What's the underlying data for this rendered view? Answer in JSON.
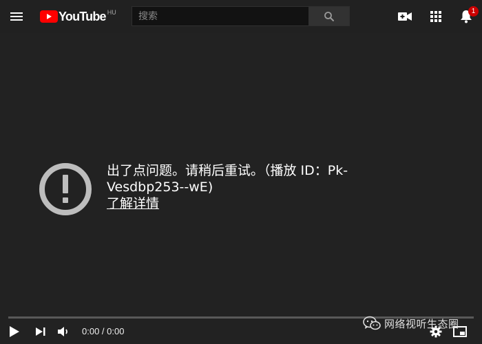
{
  "header": {
    "brand": "YouTube",
    "region": "HU",
    "search": {
      "placeholder": "搜索",
      "value": ""
    },
    "icons": {
      "menu": "hamburger-icon",
      "search": "search-icon",
      "create": "video-camera-icon",
      "apps": "apps-grid-icon",
      "notifications": "bell-icon"
    },
    "notification_count": "1"
  },
  "error": {
    "icon": "exclamation-circle-icon",
    "message_line1": "出了点问题。请稍后重试。（播放 ID：Pk-",
    "message_line2": "Vesdbp253--wE)",
    "learn_more": "了解详情"
  },
  "player": {
    "progress": 0,
    "time": "0:00 / 0:00",
    "icons": {
      "play": "play-icon",
      "next": "next-icon",
      "volume": "volume-icon",
      "settings": "gear-icon",
      "miniplayer": "miniplayer-icon"
    }
  },
  "watermark": {
    "text": "网络视听生态圈",
    "icon": "wechat-icon"
  },
  "colors": {
    "background": "#222222",
    "topbar": "#212121",
    "brand_red": "#ff0000",
    "badge": "#cc0000",
    "error_icon": "#bdbdbd"
  }
}
